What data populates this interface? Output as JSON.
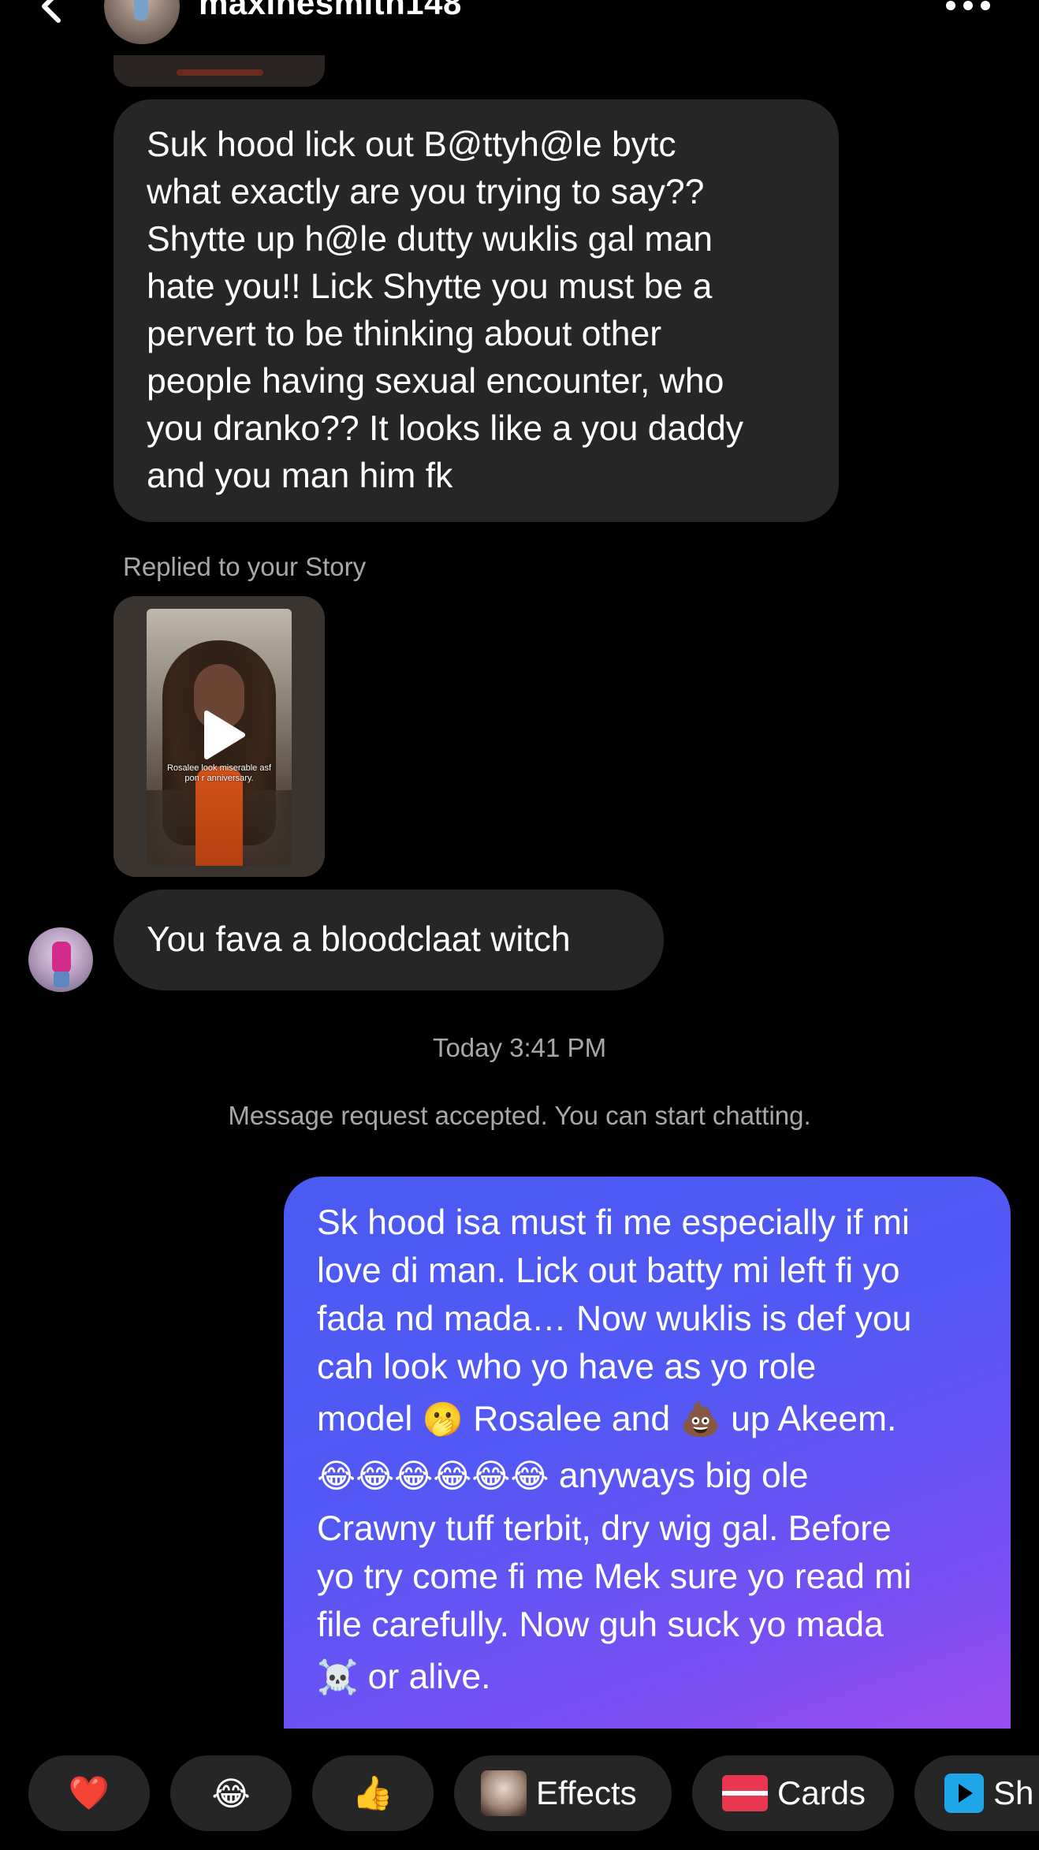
{
  "header": {
    "username": "maxinesmith148"
  },
  "messages": {
    "incoming_1": [
      "Suk hood lick out B@ttyh@le bytc",
      "what exactly are you trying to say??",
      "Shytte up h@le dutty wuklis gal man",
      "hate you!! Lick  Shytte you must be a",
      "pervert to be thinking about other",
      "people having sexual encounter, who",
      "you dranko?? It looks like a you daddy",
      "and you man him fk"
    ],
    "story_reply_label": "Replied to your Story",
    "story_caption": [
      "Rosalee look miserable asf",
      "pon r anniversary."
    ],
    "incoming_2": "You fava a bloodclaat witch",
    "timestamp": "Today 3:41 PM",
    "notice": "Message request accepted. You can start chatting.",
    "outgoing": {
      "line1": "Sk hood isa must fi me especially if mi",
      "line2": "love di man. Lick out batty mi left fi yo",
      "line3": "fada nd mada… Now wuklis is def you",
      "line4": "cah look who yo have as yo role",
      "line5_a": "model ",
      "line5_emoji1": "🫢",
      "line5_b": " Rosalee and ",
      "line5_emoji2": "💩",
      "line5_c": " up Akeem.",
      "line6_emoji": "😂😂😂😂😂😂",
      "line6_text": " anyways big ole",
      "line7": "Crawny tuff terbit, dry wig gal. Before",
      "line8": "yo try come fi me Mek sure yo read mi",
      "line9": "file carefully. Now guh suck yo mada",
      "line10_emoji": "☠️",
      "line10_text": " or alive."
    }
  },
  "quick_reactions": {
    "heart": "❤️",
    "joy": "😂",
    "thumbs_up": "👍",
    "effects_label": "Effects",
    "cards_label": "Cards",
    "share_label": "Sh"
  },
  "colors": {
    "background": "#000000",
    "incoming_bubble": "#262626",
    "outgoing_gradient_start": "#4a5bf2",
    "outgoing_gradient_end": "#9a4cf0",
    "secondary_text": "#a8a8a8"
  }
}
